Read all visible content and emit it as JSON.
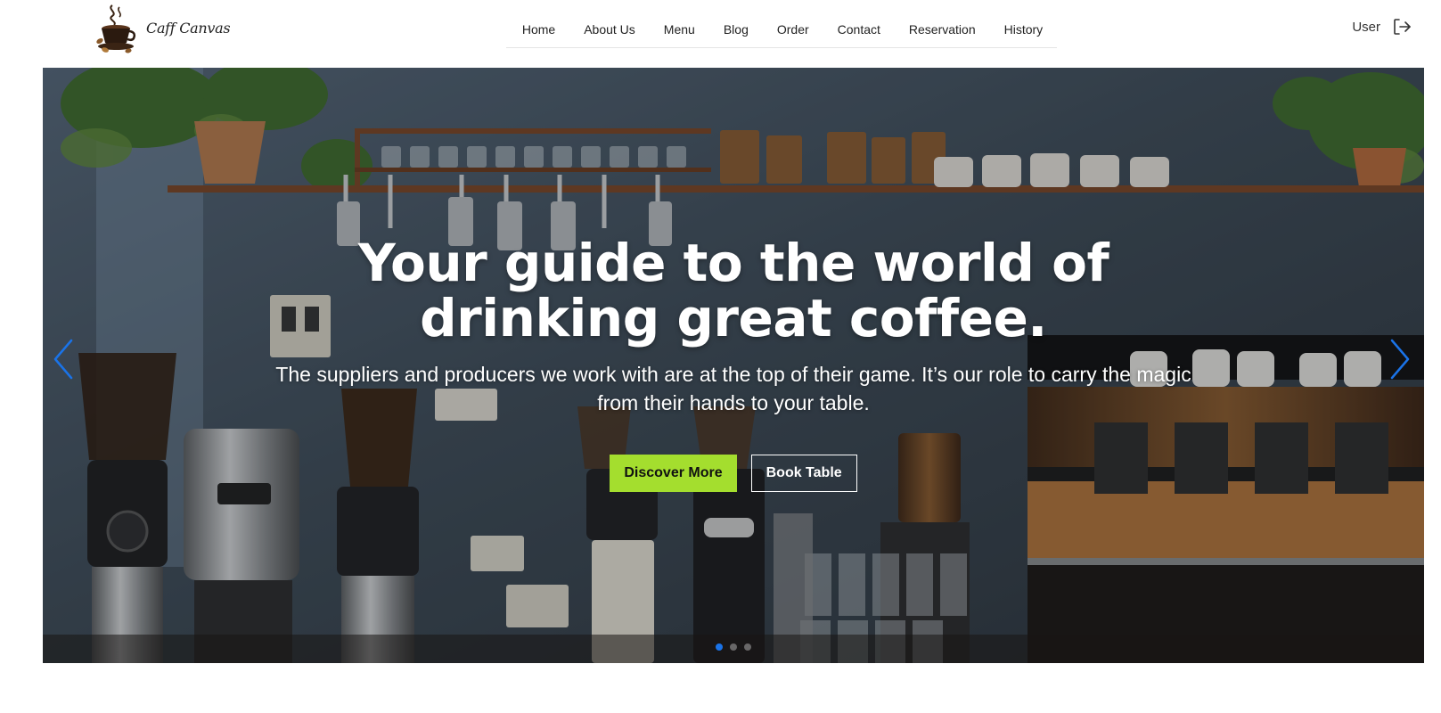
{
  "brand": {
    "name": "Caff Canvas",
    "logo_icon": "coffee-cup-logo-icon"
  },
  "nav": {
    "items": [
      {
        "label": "Home"
      },
      {
        "label": "About Us"
      },
      {
        "label": "Menu"
      },
      {
        "label": "Blog"
      },
      {
        "label": "Order"
      },
      {
        "label": "Contact"
      },
      {
        "label": "Reservation"
      },
      {
        "label": "History"
      }
    ]
  },
  "user": {
    "label": "User",
    "logout_icon": "logout-icon"
  },
  "hero": {
    "title": "Your guide to the world of drinking great coffee.",
    "subtitle": "The suppliers and producers we work with are at the top of their game. It’s our role to carry the magic from their hands to your table.",
    "primary_button": "Discover More",
    "secondary_button": "Book Table",
    "prev_icon": "chevron-left-icon",
    "next_icon": "chevron-right-icon",
    "slide_count": 3,
    "active_slide": 1,
    "background_image": "coffee-bar-with-grinders-and-espresso-machine"
  },
  "colors": {
    "accent": "#a4de2e",
    "carousel_control": "#1a73e8",
    "text_dark": "#222222",
    "hero_text": "#ffffff"
  }
}
